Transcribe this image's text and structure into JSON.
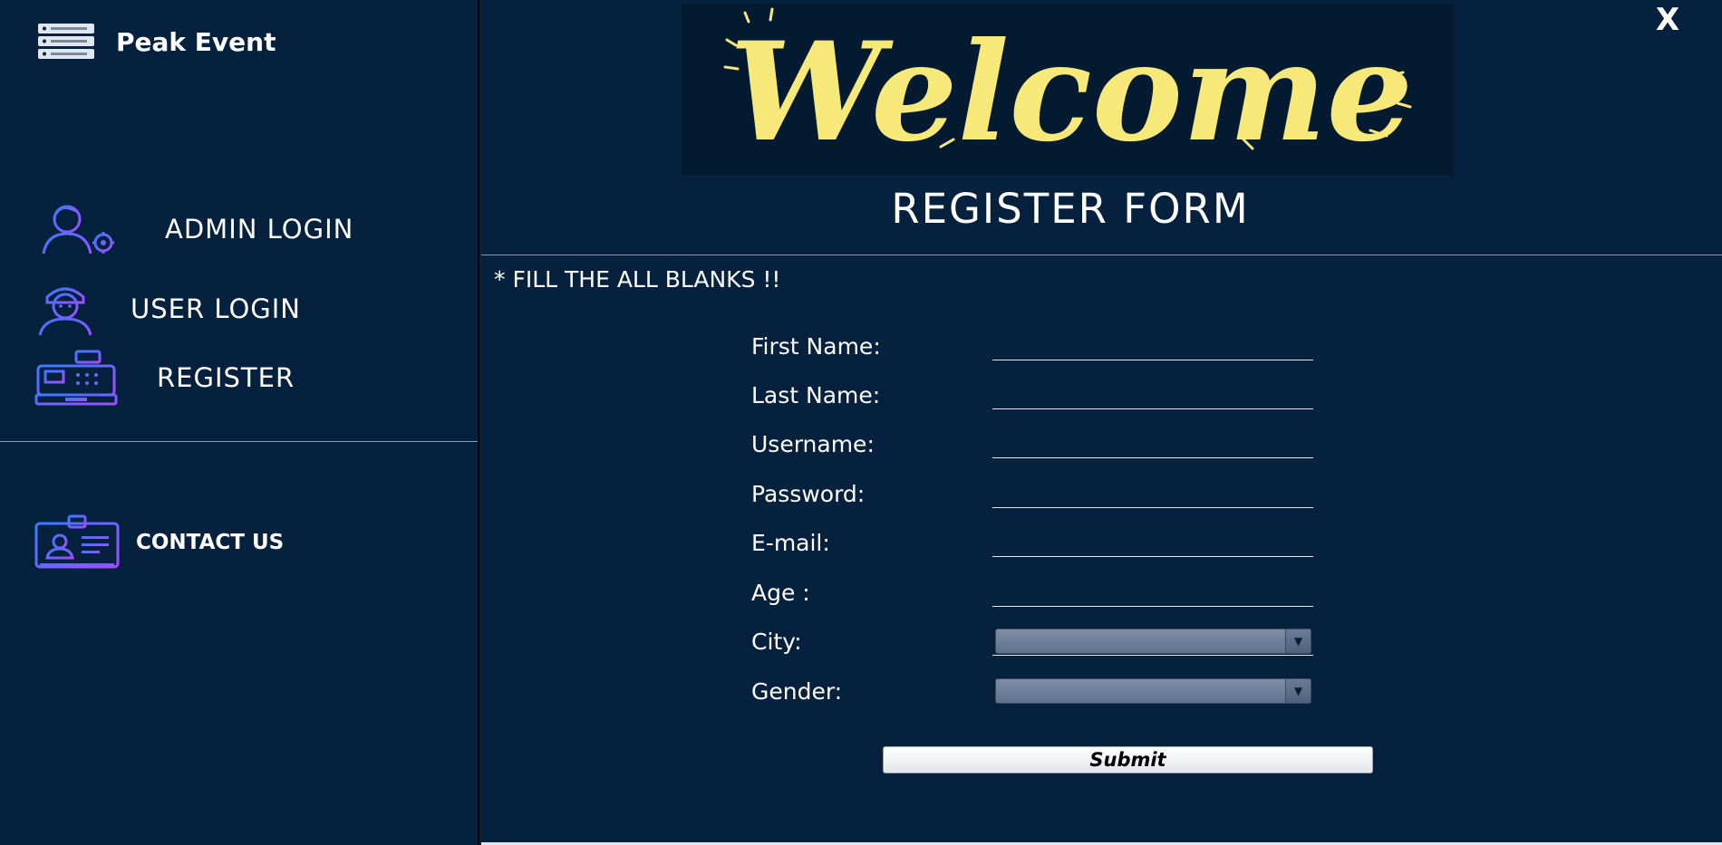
{
  "app": {
    "brand_name": "Peak Event",
    "brand_icon": "server-rack-icon"
  },
  "sidebar": {
    "items": [
      {
        "label": "ADMIN LOGIN",
        "icon": "admin-gear-icon"
      },
      {
        "label": "USER LOGIN",
        "icon": "user-icon"
      },
      {
        "label": "REGISTER",
        "icon": "cash-register-icon"
      },
      {
        "label": "CONTACT US",
        "icon": "id-card-icon"
      }
    ]
  },
  "header": {
    "banner_text": "Welcome",
    "close_label": "X",
    "form_title": "REGISTER FORM"
  },
  "form": {
    "note": "* FILL THE ALL BLANKS !!",
    "fields": {
      "first_name": {
        "label": "First Name:",
        "value": ""
      },
      "last_name": {
        "label": "Last Name:",
        "value": ""
      },
      "username": {
        "label": "Username:",
        "value": ""
      },
      "password": {
        "label": "Password:",
        "value": ""
      },
      "email": {
        "label": "E-mail:",
        "value": ""
      },
      "age": {
        "label": "Age :",
        "value": ""
      },
      "city": {
        "label": "City:",
        "selected": ""
      },
      "gender": {
        "label": "Gender:",
        "selected": ""
      }
    },
    "submit_label": "Submit"
  },
  "colors": {
    "background": "#05213d",
    "accent_purple": "#8a4dff",
    "accent_blue": "#3a7bff",
    "banner_yellow": "#f7e87a"
  }
}
